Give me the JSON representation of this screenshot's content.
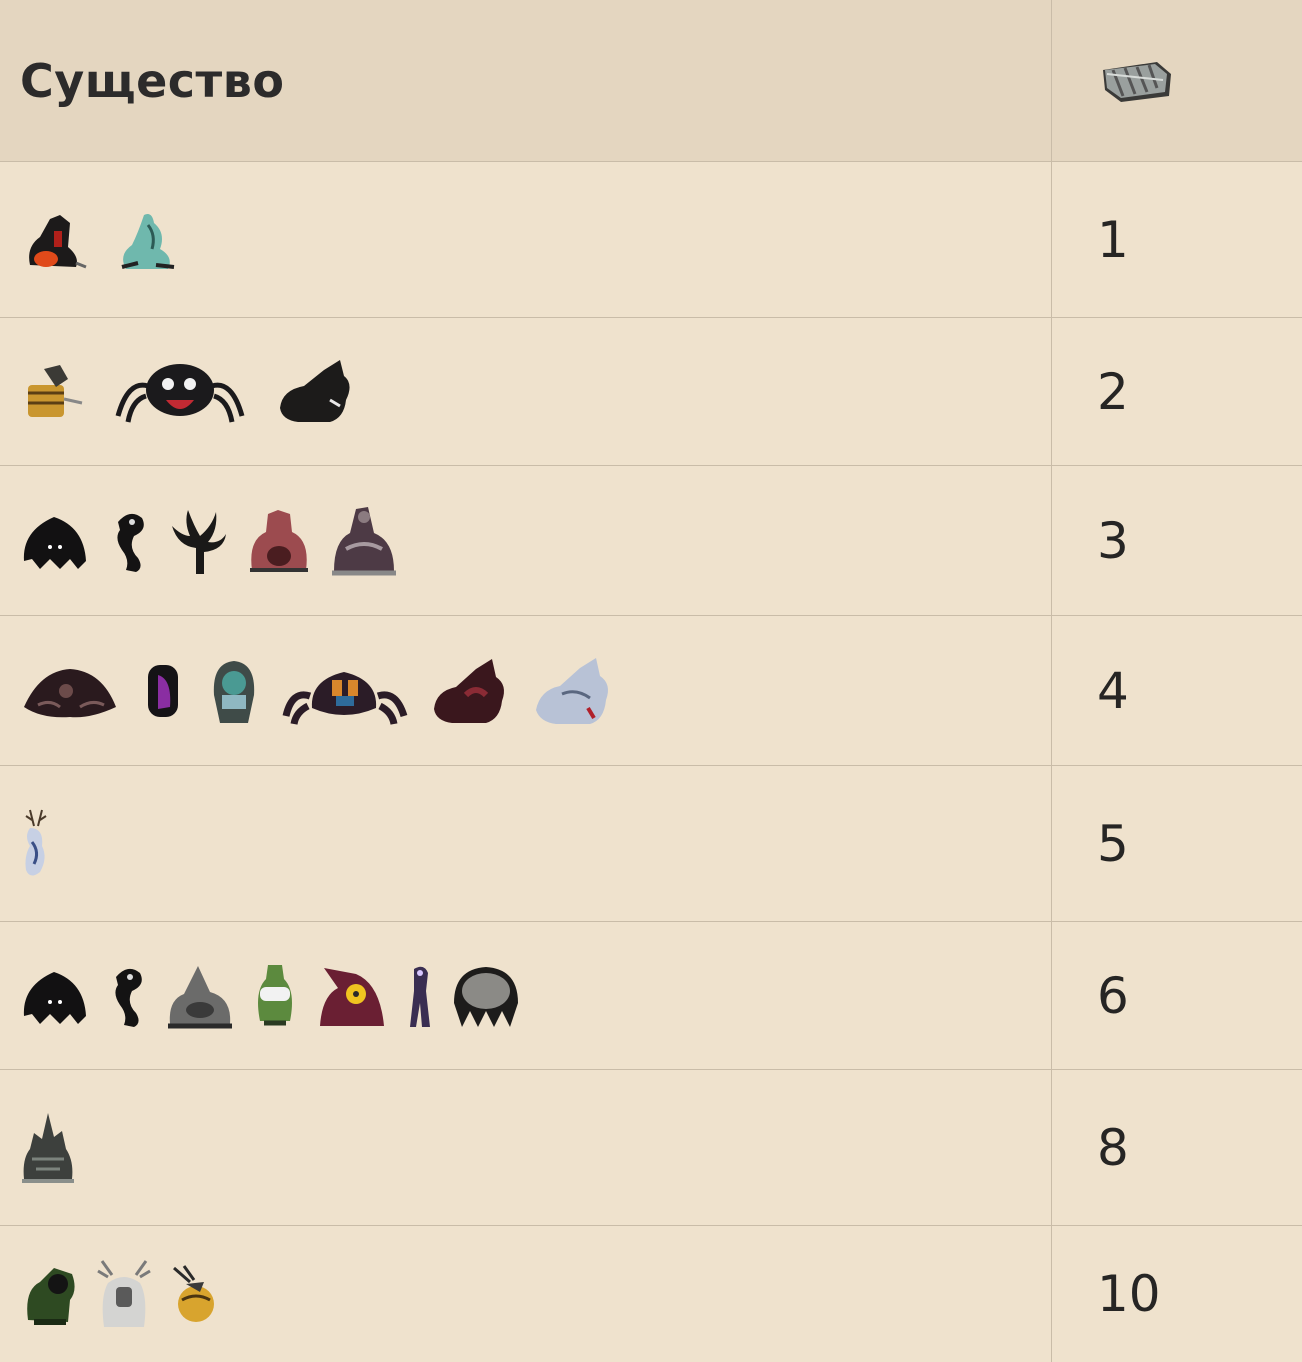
{
  "header": {
    "creature_label": "Существо",
    "resource_icon": "bandage-roll-icon"
  },
  "rows": [
    {
      "value": "1",
      "creatures": [
        "red-hound-icon",
        "ghost-icon"
      ]
    },
    {
      "value": "2",
      "creatures": [
        "bee-keeper-icon",
        "spider-queen-icon",
        "hound-icon"
      ]
    },
    {
      "value": "3",
      "creatures": [
        "shadow-crawler-icon",
        "shadow-hand-icon",
        "tree-shadow-icon",
        "pig-house-icon",
        "merm-house-icon"
      ]
    },
    {
      "value": "4",
      "creatures": [
        "mound-icon",
        "purple-slurper-icon",
        "tentacle-helm-icon",
        "crab-king-icon",
        "varg-icon",
        "ice-hound-icon"
      ]
    },
    {
      "value": "5",
      "creatures": [
        "deer-icon"
      ]
    },
    {
      "value": "6",
      "creatures": [
        "shadow-crawler-icon",
        "shadow-hand-icon",
        "rock-lobster-icon",
        "slurtle-icon",
        "witch-mole-icon",
        "nightmare-icon",
        "cave-spider-icon"
      ]
    },
    {
      "value": "8",
      "creatures": [
        "spiky-rock-icon"
      ]
    },
    {
      "value": "10",
      "creatures": [
        "clockwork-knight-icon",
        "antlion-icon",
        "beequeen-icon"
      ]
    }
  ]
}
